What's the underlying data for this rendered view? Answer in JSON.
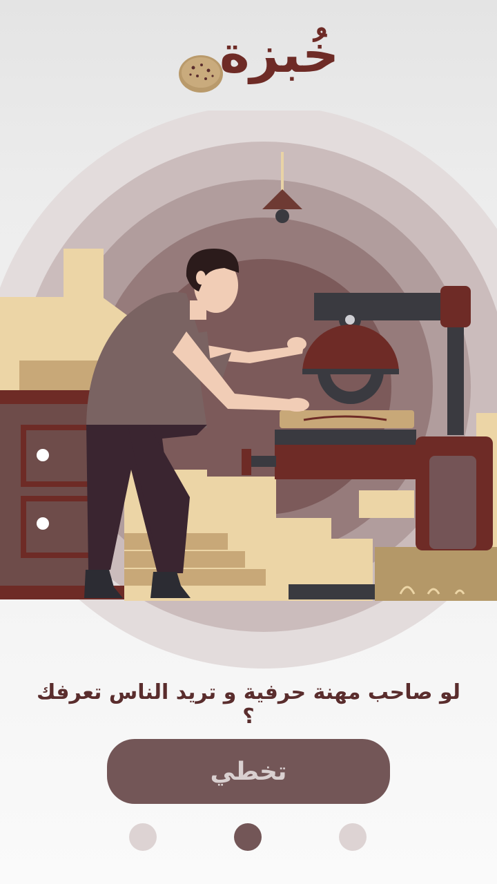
{
  "app": {
    "logo_text": "خُبزة"
  },
  "onboarding": {
    "headline": "لو صاحب مهنة حرفية و تريد الناس تعرفك ؟",
    "skip_label": "تخطي",
    "page_indicator": {
      "total": 3,
      "active": 2
    }
  },
  "colors": {
    "brand": "#6e2b26",
    "button": "#735657",
    "button_text": "#d9d0d0",
    "dot_inactive": "#ddd3d3"
  },
  "icons": {
    "logo": "bread-loaf-icon",
    "illustration": "carpenter-at-saw-illustration"
  }
}
